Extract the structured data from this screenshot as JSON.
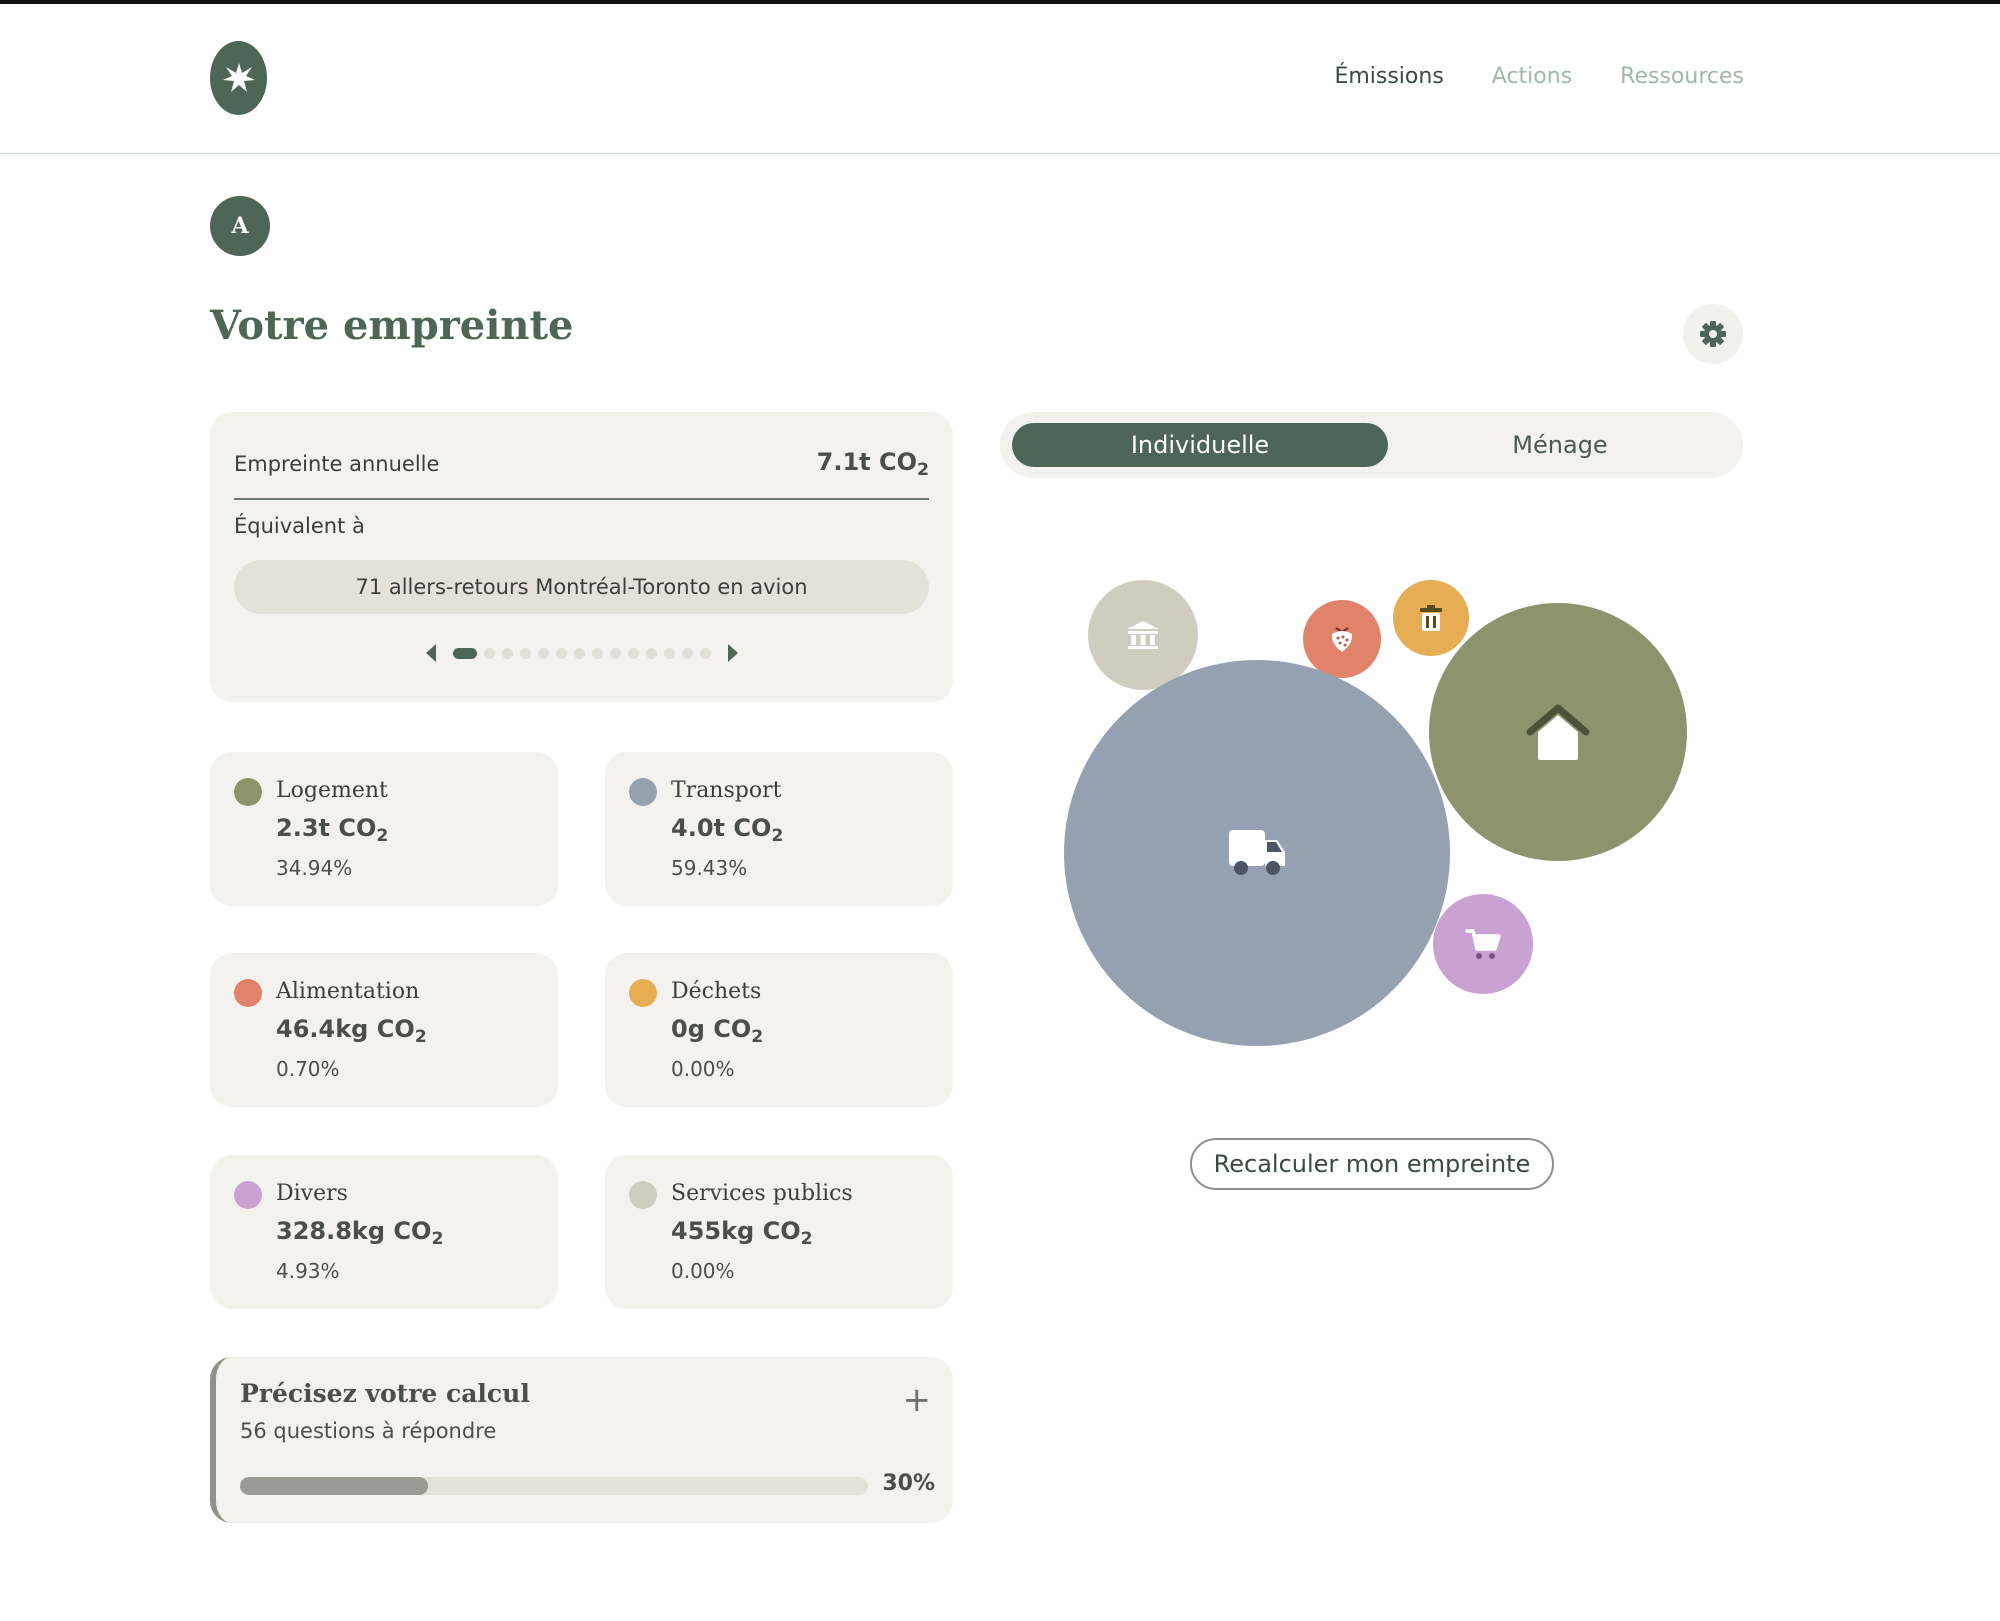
{
  "nav": {
    "items": [
      {
        "label": "Émissions",
        "active": true
      },
      {
        "label": "Actions",
        "active": false
      },
      {
        "label": "Ressources",
        "active": false
      }
    ]
  },
  "avatar": {
    "initial": "A"
  },
  "page_title": "Votre empreinte",
  "summary": {
    "annual_label": "Empreinte annuelle",
    "annual_value": "7.1t CO",
    "annual_value_sub": "2",
    "equivalent_label": "Équivalent à",
    "equivalent_text": "71 allers-retours Montréal-Toronto en avion",
    "pager_total": 14,
    "pager_active": 0
  },
  "categories": [
    {
      "name": "Logement",
      "value": "2.3t CO",
      "sub": "2",
      "pct": "34.94%",
      "color": "#8c936d",
      "icon": "house-icon"
    },
    {
      "name": "Transport",
      "value": "4.0t CO",
      "sub": "2",
      "pct": "59.43%",
      "color": "#95a1b1",
      "icon": "truck-icon"
    },
    {
      "name": "Alimentation",
      "value": "46.4kg CO",
      "sub": "2",
      "pct": "0.70%",
      "color": "#e0836a",
      "icon": "strawberry-icon"
    },
    {
      "name": "Déchets",
      "value": "0g CO",
      "sub": "2",
      "pct": "0.00%",
      "color": "#e6ad55",
      "icon": "trash-icon"
    },
    {
      "name": "Divers",
      "value": "328.8kg CO",
      "sub": "2",
      "pct": "4.93%",
      "color": "#c9a2d2",
      "icon": "cart-icon"
    },
    {
      "name": "Services publics",
      "value": "455kg CO",
      "sub": "2",
      "pct": "0.00%",
      "color": "#cfcdc0",
      "icon": "bank-icon"
    }
  ],
  "precise": {
    "title": "Précisez votre calcul",
    "subtitle": "56 questions à répondre",
    "progress_pct": "30%",
    "progress_value": 0.3
  },
  "toggle": {
    "active_label": "Individuelle",
    "inactive_label": "Ménage"
  },
  "recalc_label": "Recalculer mon empreinte",
  "colors": {
    "brand": "#4e6655",
    "card": "#f3f2ee"
  }
}
